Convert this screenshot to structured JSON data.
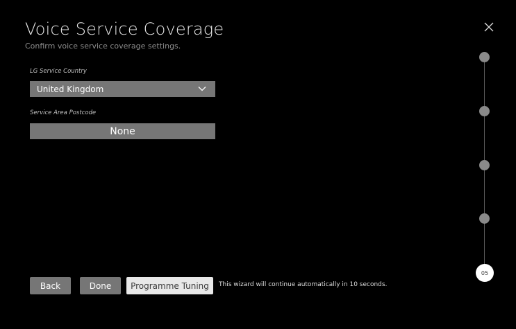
{
  "header": {
    "title": "Voice Service Coverage",
    "subtitle": "Confirm voice service coverage settings."
  },
  "form": {
    "country_label": "LG Service Country",
    "country_value": "United Kingdom",
    "postcode_label": "Service Area Postcode",
    "postcode_value": "None"
  },
  "buttons": {
    "back": "Back",
    "done": "Done",
    "tuning": "Programme Tuning"
  },
  "status": {
    "auto_message": "This wizard will continue automatically in 10 seconds."
  },
  "progress": {
    "current_step_label": "05",
    "total_steps": 5,
    "current_step": 5
  },
  "icons": {
    "close": "close-icon",
    "dropdown": "chevron-down-icon"
  },
  "colors": {
    "background": "#000000",
    "control": "#767676",
    "primary_button": "#e8e8e8",
    "step_inactive": "#8a8a8a"
  }
}
